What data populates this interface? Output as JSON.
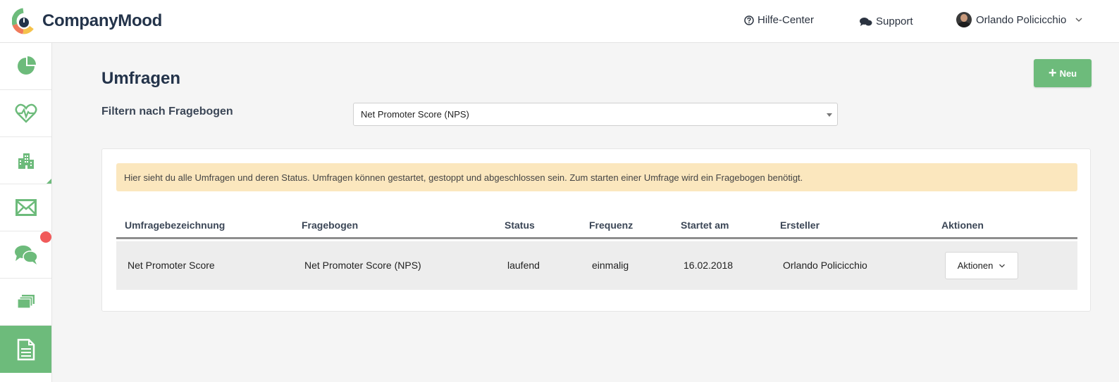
{
  "app": {
    "brand": "CompanyMood",
    "colors": {
      "accent": "#6dbb7b",
      "navy": "#23334a",
      "info_bg": "#fbe7be",
      "badge": "#f05a5a"
    }
  },
  "header": {
    "help_label": "Hilfe-Center",
    "support_label": "Support",
    "user_name": "Orlando Policicchio"
  },
  "sidebar": {
    "items": [
      {
        "icon": "pie-chart-icon",
        "active": false
      },
      {
        "icon": "heart-pulse-icon",
        "active": false
      },
      {
        "icon": "buildings-icon",
        "active": false
      },
      {
        "icon": "envelope-icon",
        "active": false
      },
      {
        "icon": "chat-bubbles-icon",
        "active": false,
        "badge": true
      },
      {
        "icon": "stack-icon",
        "active": false
      },
      {
        "icon": "document-icon",
        "active": true
      }
    ]
  },
  "main": {
    "title": "Umfragen",
    "new_button_label": "Neu",
    "filter_label": "Filtern nach Fragebogen",
    "filter_value": "Net Promoter Score (NPS)",
    "info_text": "Hier sieht du alle Umfragen und deren Status. Umfragen können gestartet, gestoppt und abgeschlossen sein. Zum starten einer Umfrage wird ein Fragebogen benötigt.",
    "table": {
      "columns": [
        "Umfragebezeichnung",
        "Fragebogen",
        "Status",
        "Frequenz",
        "Startet am",
        "Ersteller",
        "Aktionen"
      ],
      "rows": [
        {
          "name": "Net Promoter Score",
          "questionnaire": "Net Promoter Score (NPS)",
          "status": "laufend",
          "frequency": "einmalig",
          "start": "16.02.2018",
          "creator": "Orlando Policicchio",
          "action_label": "Aktionen"
        }
      ]
    }
  }
}
